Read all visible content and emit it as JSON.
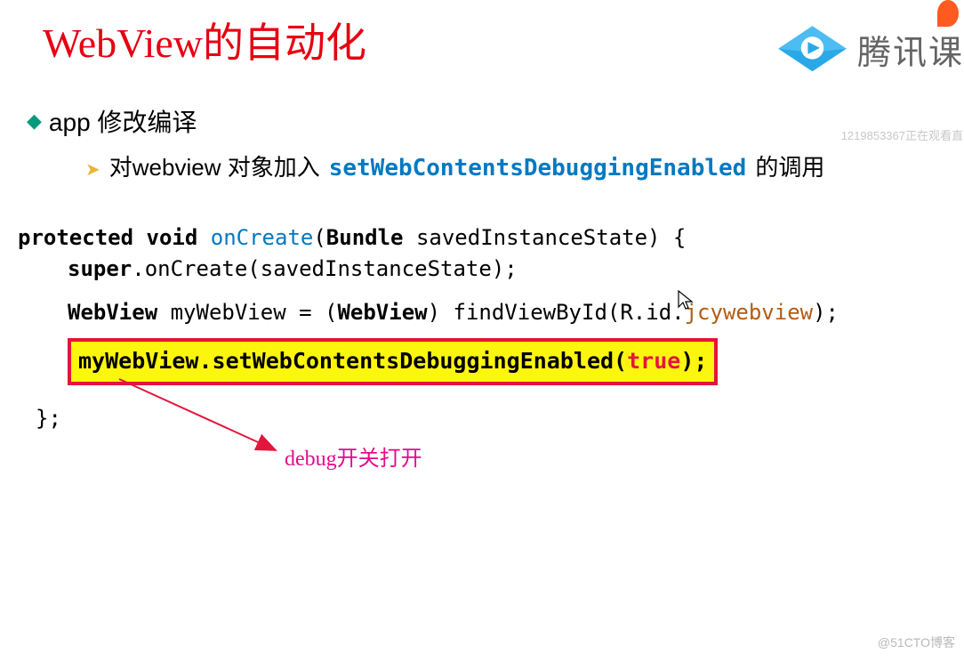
{
  "title": "WebView的自动化",
  "logo_text": "腾讯课",
  "bullets": {
    "b1": "app 修改编译",
    "b2_pre": "对webview 对象加入",
    "b2_code": "setWebContentsDebuggingEnabled",
    "b2_post": " 的调用"
  },
  "code": {
    "line1": {
      "kw1": "protected",
      "kw2": "void",
      "name": "onCreate",
      "paren": "(",
      "type": "Bundle",
      "arg": " savedInstanceState) {"
    },
    "line2": {
      "supercall": "super",
      "dot": ".onCreate(savedInstanceState);"
    },
    "line3": {
      "type": "WebView",
      "rest": " myWebView = (",
      "type2": "WebView",
      "rest2": ") findViewById(R.id.",
      "var": "jcywebview",
      "end": ");"
    },
    "hl": {
      "pre": "myWebView.setWebContentsDebuggingEnabled(",
      "val": "true",
      "post": ");"
    },
    "close": "};"
  },
  "annotation": "debug开关打开",
  "watermarks": {
    "top": "1219853367正在观看直",
    "bottom": "@51CTO博客"
  }
}
